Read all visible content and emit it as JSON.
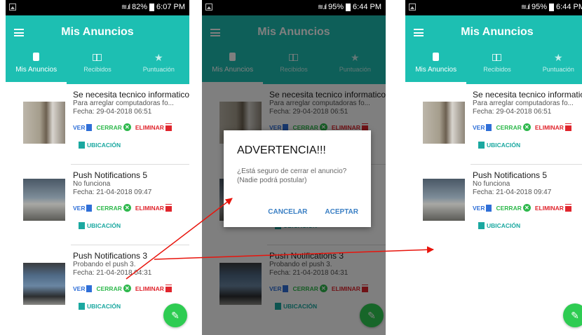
{
  "screens": [
    {
      "status_text": "82%",
      "time": "6:07 PM"
    },
    {
      "status_text": "95%",
      "time": "6:44 PM"
    },
    {
      "status_text": "95%",
      "time": "6:44 PM"
    }
  ],
  "appbar": {
    "title": "Mis Anuncios",
    "tabs": [
      {
        "label": "Mis Anuncios",
        "icon": "phone-icon"
      },
      {
        "label": "Recibidos",
        "icon": "book-icon"
      },
      {
        "label": "Puntuación",
        "icon": "star-icon"
      }
    ]
  },
  "actions": {
    "ver": "VER",
    "cerrar": "CERRAR",
    "eliminar": "ELIMINAR",
    "ubicacion": "UBICACIÓN"
  },
  "items": [
    {
      "title": "Se necesita tecnico informatico",
      "subtitle": "Para arreglar computadoras fo...",
      "date": "Fecha: 29-04-2018 06:51"
    },
    {
      "title": "Push Notifications 5",
      "subtitle": "No funciona",
      "date": "Fecha: 21-04-2018 09:47"
    },
    {
      "title": "Push Notifications 3",
      "subtitle": "Probando el push 3.",
      "date": "Fecha: 21-04-2018 04:31"
    }
  ],
  "dialog": {
    "title": "ADVERTENCIA!!!",
    "message": "¿Está seguro de cerrar el anuncio? (Nadie podrá postular)",
    "cancel": "CANCELAR",
    "accept": "ACEPTAR"
  },
  "colors": {
    "primary": "#1dbfb2",
    "fab": "#2ecc52",
    "ver": "#2f6fd8",
    "cerrar": "#2eb84c",
    "eliminar": "#e0252d",
    "arrow": "#e8140c"
  }
}
